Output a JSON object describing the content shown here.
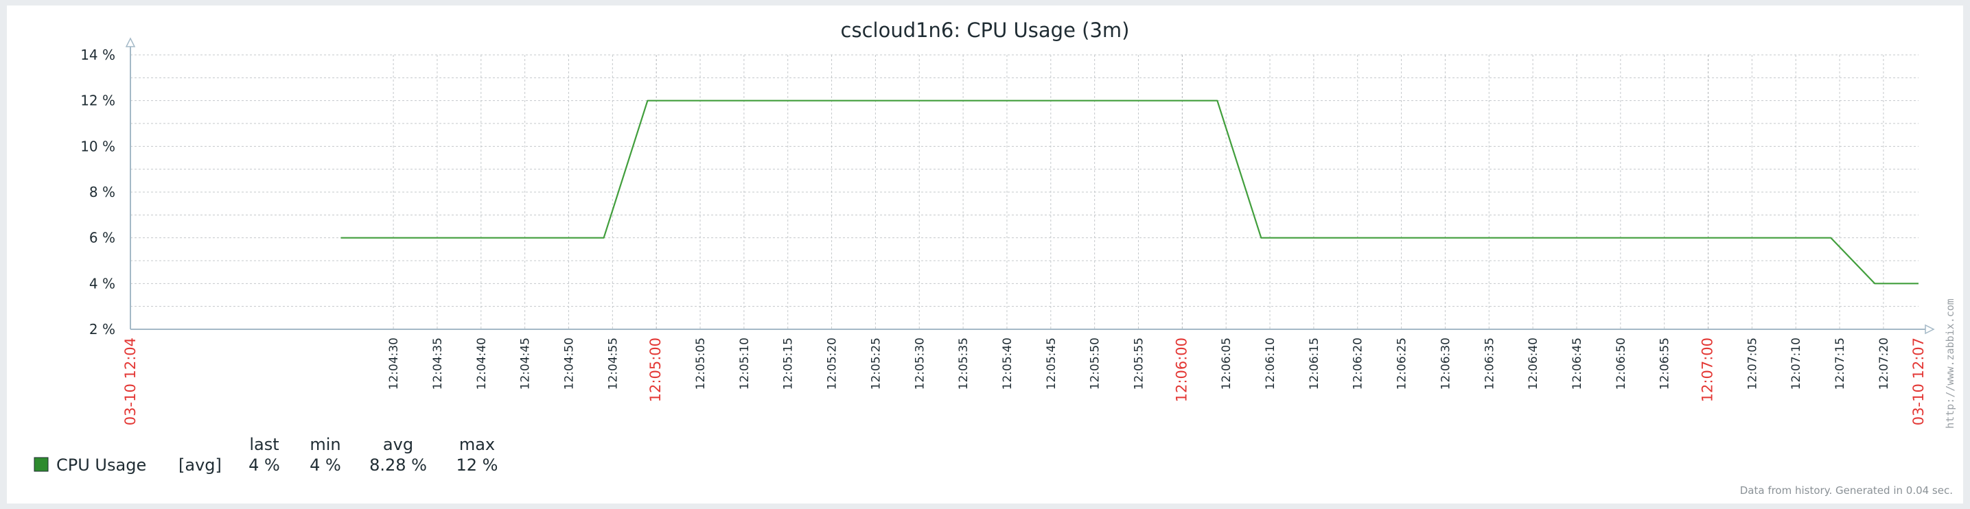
{
  "chart_data": {
    "type": "line",
    "title": "cscloud1n6: CPU Usage (3m)",
    "ylim": [
      2,
      14
    ],
    "y_unit": "%",
    "y_ticks": [
      "2 %",
      "4 %",
      "6 %",
      "8 %",
      "10 %",
      "12 %",
      "14 %"
    ],
    "y_tick_values": [
      2,
      4,
      6,
      8,
      10,
      12,
      14
    ],
    "x_start_label": "03-10 12:04",
    "x_end_label": "03-10 12:07",
    "x_tick_labels": [
      "12:04:30",
      "12:04:35",
      "12:04:40",
      "12:04:45",
      "12:04:50",
      "12:04:55",
      "12:05:00",
      "12:05:05",
      "12:05:10",
      "12:05:15",
      "12:05:20",
      "12:05:25",
      "12:05:30",
      "12:05:35",
      "12:05:40",
      "12:05:45",
      "12:05:50",
      "12:05:55",
      "12:06:00",
      "12:06:05",
      "12:06:10",
      "12:06:15",
      "12:06:20",
      "12:06:25",
      "12:06:30",
      "12:06:35",
      "12:06:40",
      "12:06:45",
      "12:06:50",
      "12:06:55",
      "12:07:00",
      "12:07:05",
      "12:07:10",
      "12:07:15",
      "12:07:20"
    ],
    "x_major_labels": [
      "12:05:00",
      "12:06:00",
      "12:07:00"
    ],
    "series": [
      {
        "name": "CPU Usage",
        "color": "#419e3c",
        "x": [
          "12:04:24",
          "12:04:54",
          "12:04:59",
          "12:06:04",
          "12:06:09",
          "12:07:14",
          "12:07:19",
          "12:07:24"
        ],
        "values": [
          6,
          6,
          12,
          12,
          6,
          6,
          4,
          4
        ]
      }
    ],
    "legend": {
      "placement": "bottom-left",
      "headers": [
        "last",
        "min",
        "avg",
        "max"
      ],
      "rows": [
        {
          "name": "CPU Usage",
          "func": "[avg]",
          "last": "4 %",
          "min": "4 %",
          "avg": "8.28 %",
          "max": "12 %",
          "color": "#2e8b2e"
        }
      ]
    },
    "grid": true
  },
  "footer": "Data from history. Generated in 0.04 sec.",
  "watermark": "http://www.zabbix.com",
  "colors": {
    "grid": "#c4c8cb",
    "axis": "#a4b9c7",
    "major_label": "#e33734",
    "line": "#419e3c"
  }
}
